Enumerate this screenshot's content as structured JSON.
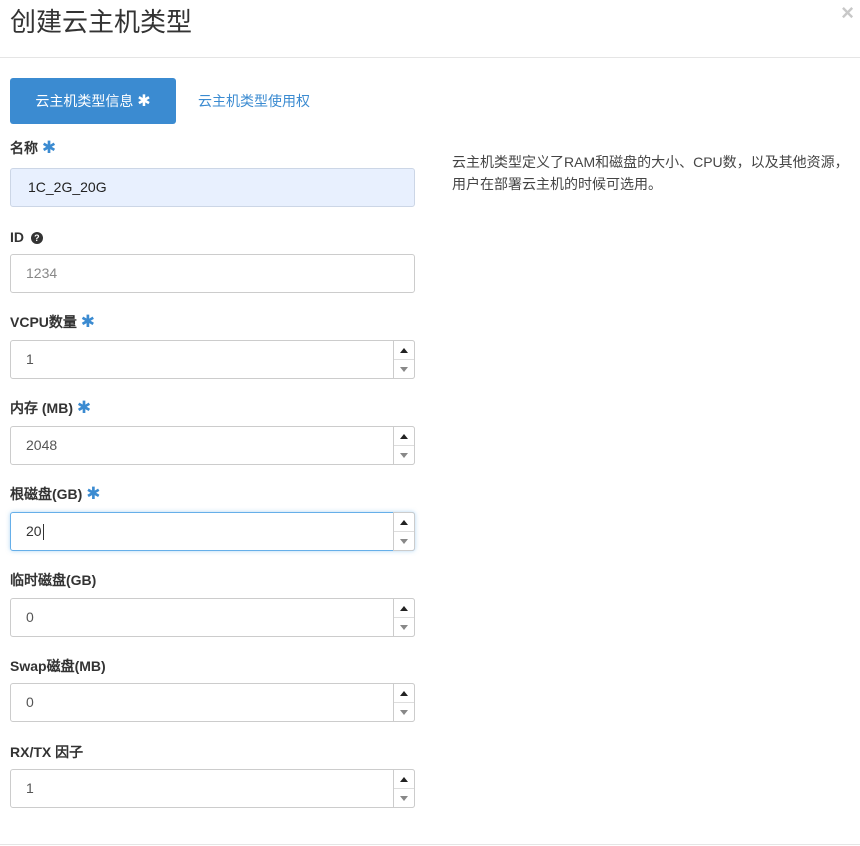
{
  "modal": {
    "title": "创建云主机类型",
    "close_icon": "×"
  },
  "tabs": {
    "info_label": "云主机类型信息",
    "info_required": "✱",
    "access_label": "云主机类型使用权"
  },
  "fields": {
    "name": {
      "label": "名称",
      "required": "✱",
      "value": "1C_2G_20G"
    },
    "id": {
      "label": "ID",
      "help_icon": "?",
      "placeholder": "1234"
    },
    "vcpus": {
      "label": "VCPU数量",
      "required": "✱",
      "value": "1"
    },
    "memory": {
      "label": "内存 (MB)",
      "required": "✱",
      "value": "2048"
    },
    "root_disk": {
      "label": "根磁盘(GB)",
      "required": "✱",
      "value": "20"
    },
    "ephemeral_disk": {
      "label": "临时磁盘(GB)",
      "value": "0"
    },
    "swap_disk": {
      "label": "Swap磁盘(MB)",
      "value": "0"
    },
    "rxtx_factor": {
      "label": "RX/TX 因子",
      "value": "1"
    }
  },
  "description": "云主机类型定义了RAM和磁盘的大小、CPU数，以及其他资源，用户在部署云主机的时候可选用。",
  "colors": {
    "accent": "#3b8bd1",
    "autofill_bg": "#e8f0fe",
    "focus_border": "#66afe9"
  }
}
